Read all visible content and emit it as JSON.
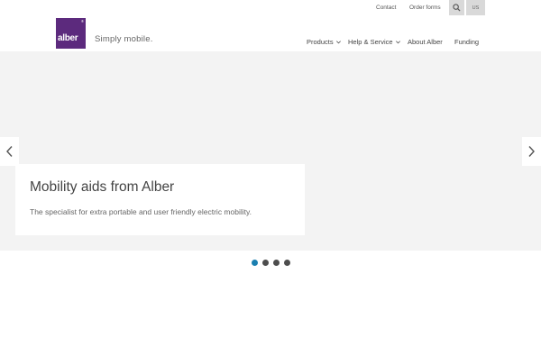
{
  "topbar": {
    "contact_label": "Contact",
    "order_forms_label": "Order forms",
    "search_icon": "search-icon",
    "lang_label": "US"
  },
  "header": {
    "logo_text": "alber",
    "logo_reg": "®",
    "tagline": "Simply mobile.",
    "brand_color": "#5c2a7d"
  },
  "nav": {
    "items": [
      {
        "label": "Products",
        "has_dropdown": true
      },
      {
        "label": "Help & Service",
        "has_dropdown": true
      },
      {
        "label": "About Alber",
        "has_dropdown": false
      },
      {
        "label": "Funding",
        "has_dropdown": false
      }
    ]
  },
  "hero": {
    "title": "Mobility aids from Alber",
    "text": "The specialist for extra portable and user friendly electric mobility.",
    "prev_icon": "chevron-left-icon",
    "next_icon": "chevron-right-icon",
    "slides_count": 4,
    "active_slide": 1,
    "active_dot_color": "#1a7fb0"
  }
}
